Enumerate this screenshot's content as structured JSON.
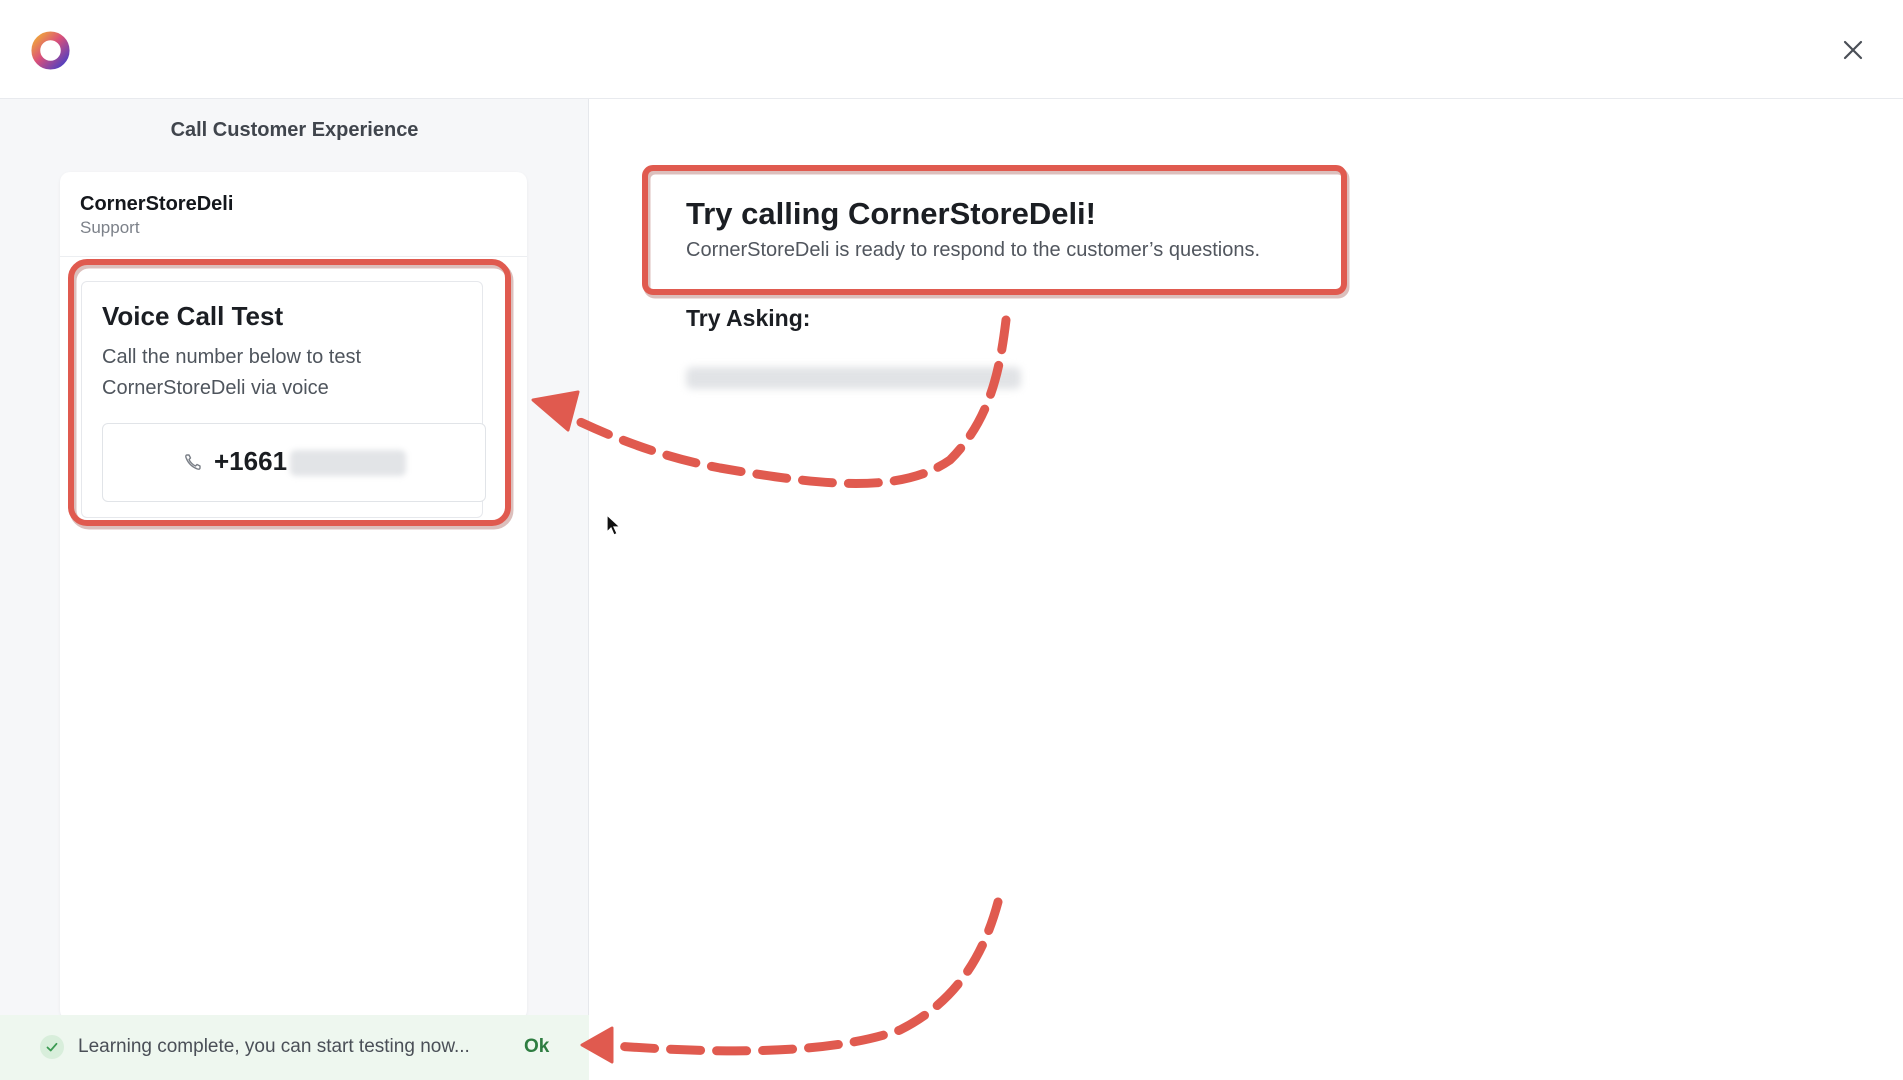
{
  "header": {
    "logo_icon": "ring-logo-icon",
    "close_icon": "close-icon"
  },
  "left_panel": {
    "title": "Call Customer Experience",
    "card": {
      "name": "CornerStoreDeli",
      "subtitle": "Support",
      "voice_test": {
        "title": "Voice Call Test",
        "description": "Call the number below to test CornerStoreDeli via voice",
        "phone_icon": "phone-icon",
        "phone_number_visible": "+1661"
      }
    }
  },
  "main": {
    "title": "Try calling CornerStoreDeli!",
    "subtitle": "CornerStoreDeli is ready to respond to the customer’s questions.",
    "try_asking_label": "Try Asking:"
  },
  "toast": {
    "icon": "check-icon",
    "message": "Learning complete, you can start testing now...",
    "ok_label": "Ok"
  },
  "annotation": {
    "highlight_color": "#e05a4f"
  },
  "colors": {
    "accent_green": "#2e7d41",
    "panel_bg": "#f6f7f9"
  }
}
